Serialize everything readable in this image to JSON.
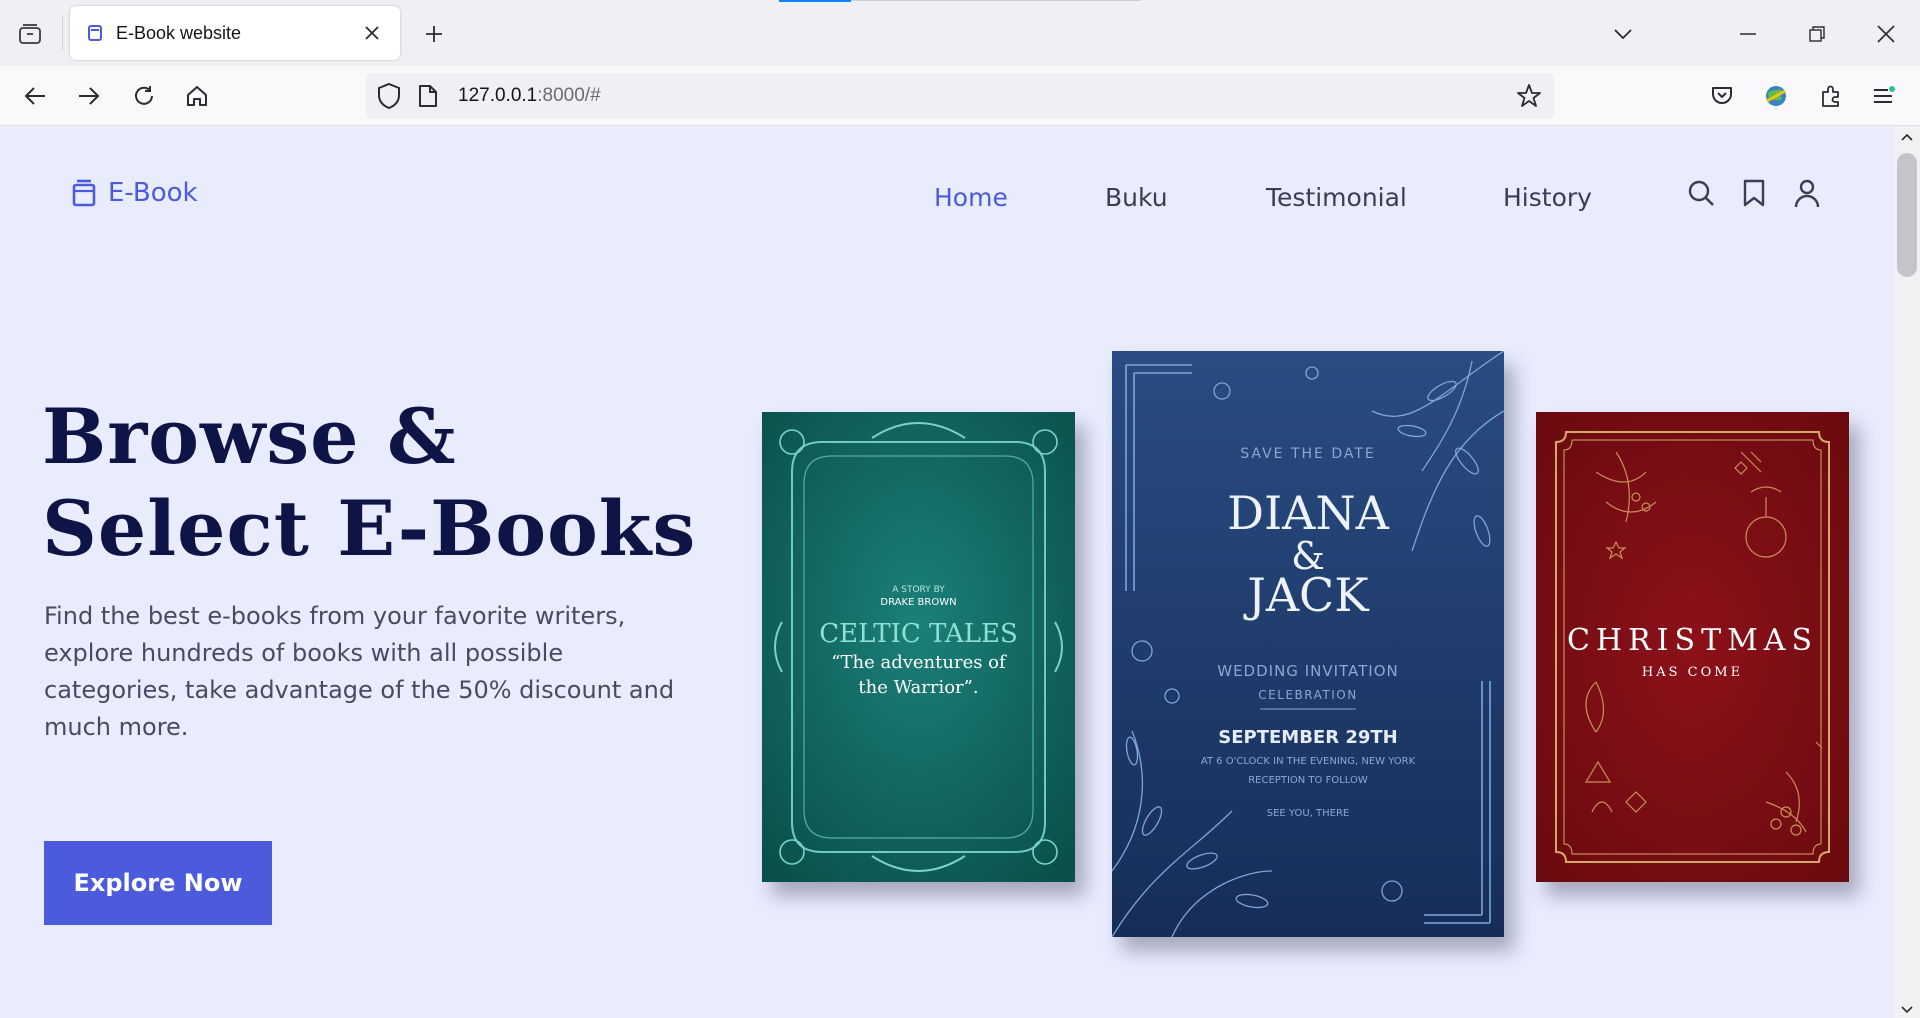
{
  "browser": {
    "tab_title": "E-Book website",
    "url_host": "127.0.0.1",
    "url_rest": ":8000/#"
  },
  "site": {
    "logo_text": "E-Book",
    "nav": [
      {
        "label": "Home",
        "active": true
      },
      {
        "label": "Buku",
        "active": false
      },
      {
        "label": "Testimonial",
        "active": false
      },
      {
        "label": "History",
        "active": false
      }
    ],
    "icons": [
      "search-icon",
      "bookmark-icon",
      "user-icon"
    ]
  },
  "hero": {
    "title_line1": "Browse &",
    "title_line2": "Select E-Books",
    "description": "Find the best e-books from your favorite writers, explore hundreds of books with all possible categories, take advantage of the 50% discount and much more.",
    "cta_label": "Explore Now"
  },
  "books": {
    "celtic": {
      "byline": "A STORY BY",
      "author": "DRAKE BROWN",
      "title": "CELTIC TALES",
      "subtitle1": "“The adventures of",
      "subtitle2": "the Warrior”."
    },
    "wedding": {
      "top": "SAVE THE DATE",
      "name1": "DIANA",
      "amp": "&",
      "name2": "JACK",
      "invite": "WEDDING INVITATION",
      "celebration": "CELEBRATION",
      "date": "SEPTEMBER 29TH",
      "detail1": "AT 6 O'CLOCK IN THE EVENING, NEW YORK",
      "detail2": "RECEPTION TO FOLLOW",
      "detail3": "SEE YOU, THERE"
    },
    "christmas": {
      "title": "CHRISTMAS",
      "subtitle": "HAS COME"
    }
  },
  "colors": {
    "accent": "#4b5bdb",
    "page_bg": "#e9ecfd",
    "title": "#0f1446",
    "celtic_bg": "#10625c",
    "wedding_bg": "#1e3a68",
    "christmas_bg": "#7c0d14"
  }
}
